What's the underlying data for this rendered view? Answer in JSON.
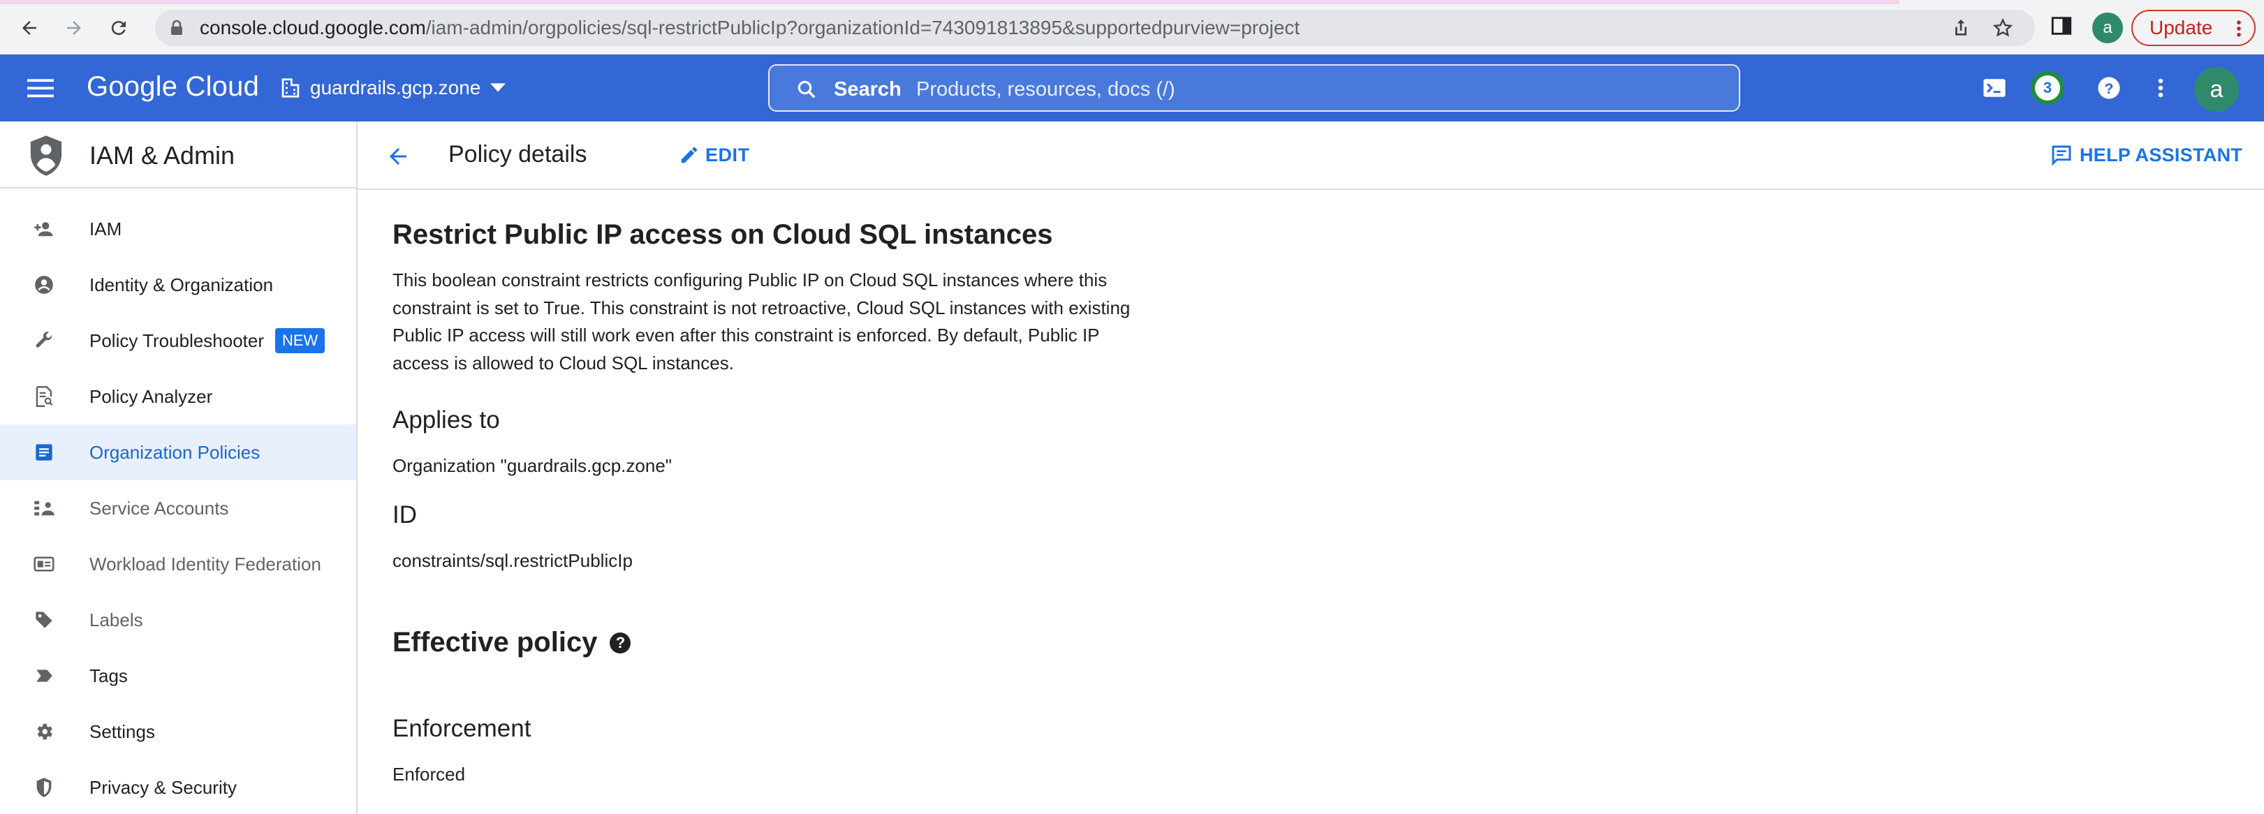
{
  "browser": {
    "url_host": "console.cloud.google.com",
    "url_path": "/iam-admin/orgpolicies/sql-restrictPublicIp?organizationId=743091813895&supportedpurview=project",
    "profile_initial": "a",
    "update_label": "Update"
  },
  "header": {
    "brand": "Google Cloud",
    "project": "guardrails.gcp.zone",
    "search_label": "Search",
    "search_placeholder": "Products, resources, docs (/)",
    "notifications_count": "3",
    "avatar_initial": "a",
    "header_color": "#3367d6"
  },
  "sidebar": {
    "title": "IAM & Admin",
    "items": [
      {
        "label": "IAM",
        "icon": "person-add-icon"
      },
      {
        "label": "Identity & Organization",
        "icon": "account-circle-icon"
      },
      {
        "label": "Policy Troubleshooter",
        "icon": "wrench-icon",
        "badge": "NEW"
      },
      {
        "label": "Policy Analyzer",
        "icon": "document-search-icon"
      },
      {
        "label": "Organization Policies",
        "icon": "policy-document-icon",
        "active": true
      },
      {
        "label": "Service Accounts",
        "icon": "service-account-icon"
      },
      {
        "label": "Workload Identity Federation",
        "icon": "id-card-icon"
      },
      {
        "label": "Labels",
        "icon": "label-tag-icon"
      },
      {
        "label": "Tags",
        "icon": "tag-arrow-icon"
      },
      {
        "label": "Settings",
        "icon": "gear-icon"
      },
      {
        "label": "Privacy & Security",
        "icon": "shield-icon"
      }
    ],
    "active_color": "#1967d2"
  },
  "toolbar": {
    "title": "Policy details",
    "edit_label": "EDIT",
    "help_label": "HELP ASSISTANT"
  },
  "policy": {
    "title": "Restrict Public IP access on Cloud SQL instances",
    "description": "This boolean constraint restricts configuring Public IP on Cloud SQL instances where this constraint is set to True. This constraint is not retroactive, Cloud SQL instances with existing Public IP access will still work even after this constraint is enforced. By default, Public IP access is allowed to Cloud SQL instances.",
    "applies_to_label": "Applies to",
    "applies_to_value": "Organization \"guardrails.gcp.zone\"",
    "id_label": "ID",
    "id_value": "constraints/sql.restrictPublicIp",
    "effective_policy_label": "Effective policy",
    "enforcement_label": "Enforcement",
    "enforcement_value": "Enforced"
  }
}
